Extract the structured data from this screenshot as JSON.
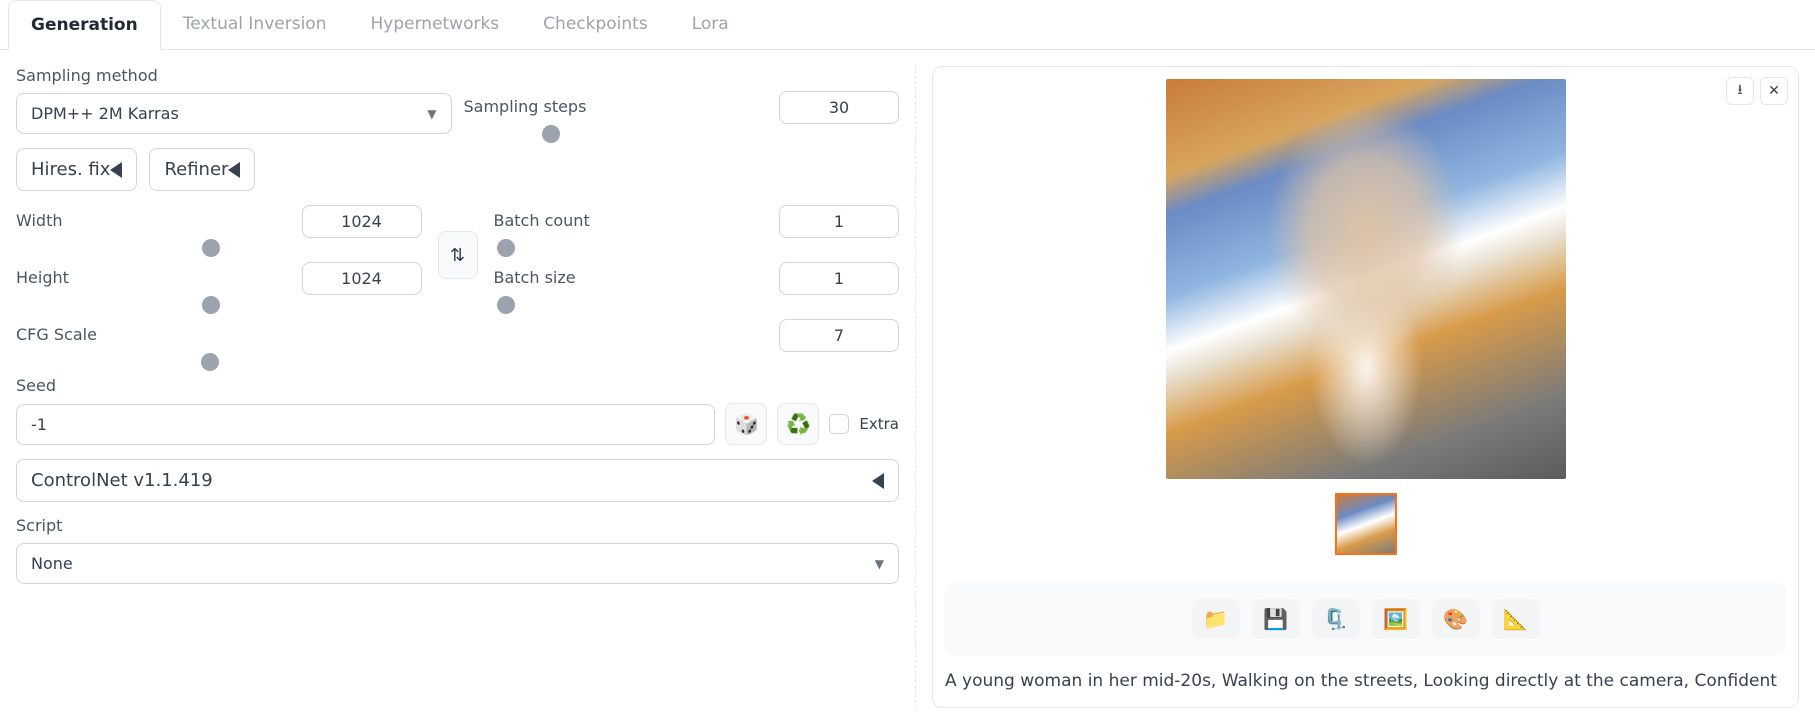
{
  "tabs": [
    "Generation",
    "Textual Inversion",
    "Hypernetworks",
    "Checkpoints",
    "Lora"
  ],
  "sampling": {
    "method_label": "Sampling method",
    "method_value": "DPM++ 2M Karras",
    "steps_label": "Sampling steps",
    "steps_value": "30"
  },
  "hires_label": "Hires. fix",
  "refiner_label": "Refiner",
  "width": {
    "label": "Width",
    "value": "1024"
  },
  "height": {
    "label": "Height",
    "value": "1024"
  },
  "batch_count": {
    "label": "Batch count",
    "value": "1"
  },
  "batch_size": {
    "label": "Batch size",
    "value": "1"
  },
  "cfg": {
    "label": "CFG Scale",
    "value": "7"
  },
  "seed": {
    "label": "Seed",
    "value": "-1",
    "extra_label": "Extra"
  },
  "controlnet_label": "ControlNet v1.1.419",
  "script": {
    "label": "Script",
    "value": "None"
  },
  "prompt_text": "A young woman in her mid-20s, Walking on the streets, Looking directly at the camera, Confident"
}
